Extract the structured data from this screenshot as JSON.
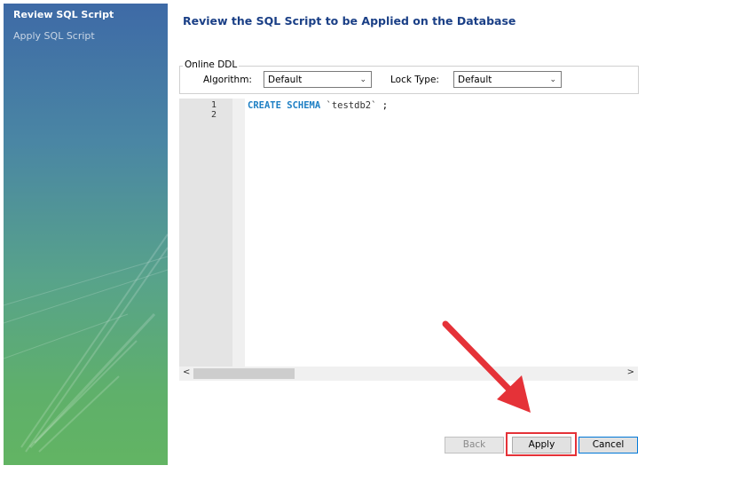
{
  "sidebar": {
    "items": [
      {
        "label": "Review SQL Script",
        "active": true
      },
      {
        "label": "Apply SQL Script",
        "active": false
      }
    ]
  },
  "main": {
    "title": "Review the SQL Script to be Applied on the Database",
    "online_ddl": {
      "legend": "Online DDL",
      "algorithm_label": "Algorithm:",
      "algorithm_value": "Default",
      "lock_type_label": "Lock Type:",
      "lock_type_value": "Default"
    },
    "editor": {
      "line_numbers": [
        "1",
        "2"
      ],
      "keyword": "CREATE SCHEMA",
      "identifier": "`testdb2`",
      "terminator": ";"
    }
  },
  "buttons": {
    "back": "Back",
    "apply": "Apply",
    "cancel": "Cancel"
  },
  "colors": {
    "title": "#1a3f86",
    "highlight": "#e53238",
    "keyword": "#1e7fc4"
  }
}
